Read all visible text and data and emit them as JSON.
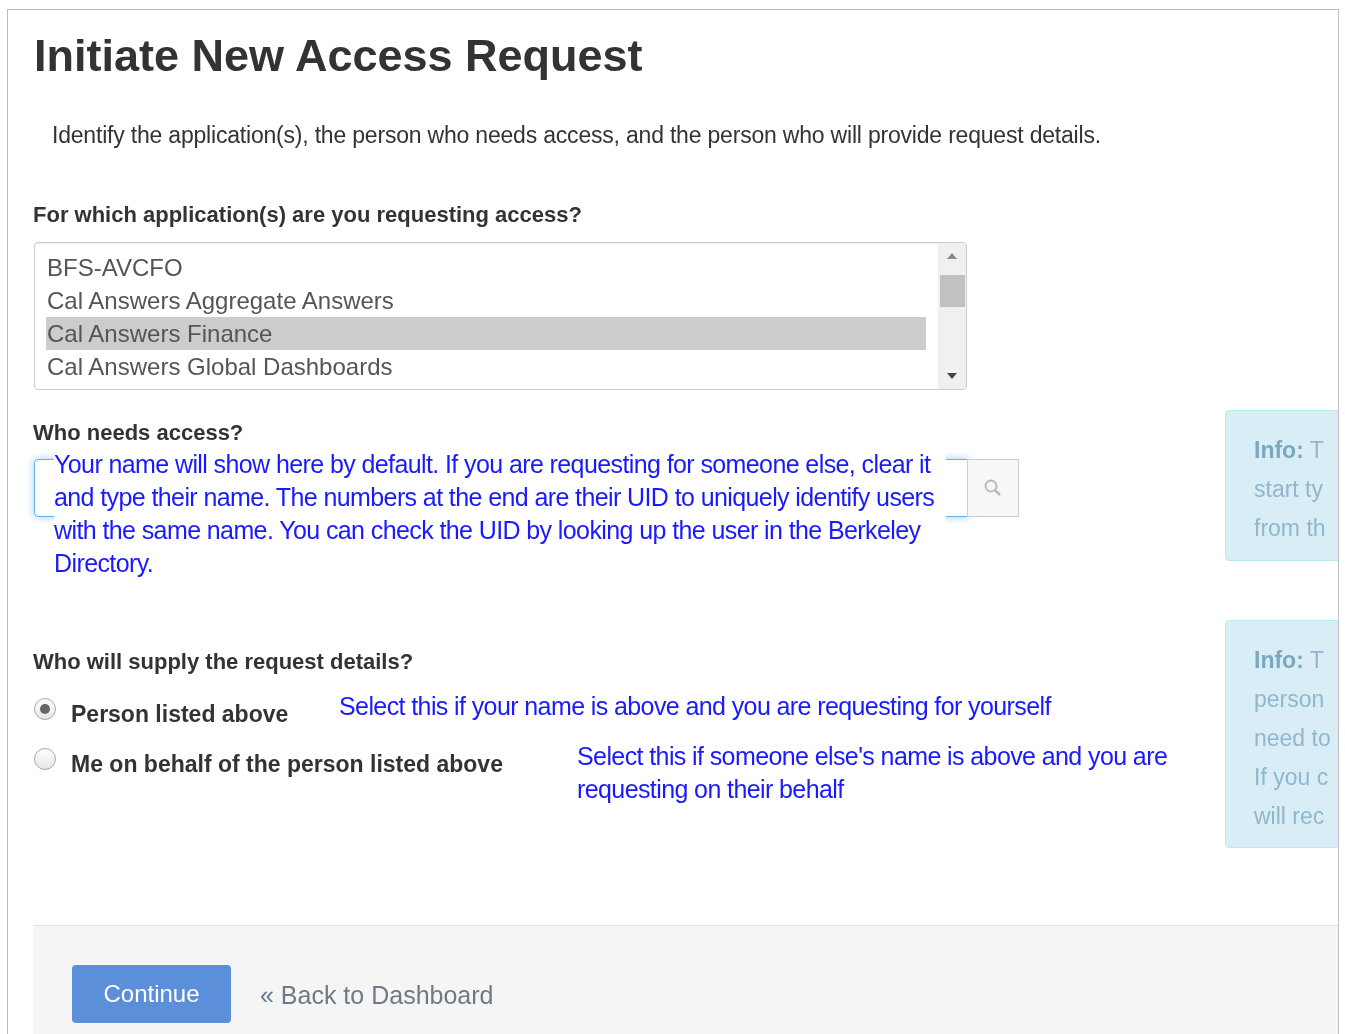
{
  "title": "Initiate New Access Request",
  "description": "Identify the application(s), the person who needs access, and the person who will provide request details.",
  "applications": {
    "label": "For which application(s) are you requesting access?",
    "options": [
      {
        "label": "BFS-AVCFO",
        "selected": false
      },
      {
        "label": "Cal Answers Aggregate Answers",
        "selected": false
      },
      {
        "label": "Cal Answers Finance",
        "selected": true
      },
      {
        "label": "Cal Answers Global Dashboards",
        "selected": false
      }
    ]
  },
  "who_needs_access": {
    "label": "Who needs access?",
    "annotation": "Your name will show here by default. If you are requesting for someone else, clear it and type their name. The numbers at the end are their UID to uniquely identify users with the same name. You can check the UID by looking up the user in the Berkeley Directory.",
    "info": {
      "heading": "Info:",
      "lines": [
        "T",
        "start ty",
        "from th"
      ]
    }
  },
  "supplier": {
    "label": "Who will supply the request details?",
    "options": [
      {
        "label": "Person listed above",
        "selected": true,
        "annotation": "Select this if your name is above and you are requesting for yourself"
      },
      {
        "label": "Me on behalf of the person listed above",
        "selected": false,
        "annotation": "Select this if someone else's name is above and you are requesting on their behalf"
      }
    ],
    "info": {
      "heading": "Info:",
      "lines": [
        "T",
        "person",
        "need to",
        "If you c",
        "will rec"
      ]
    }
  },
  "footer": {
    "continue": "Continue",
    "back": "« Back to Dashboard"
  }
}
